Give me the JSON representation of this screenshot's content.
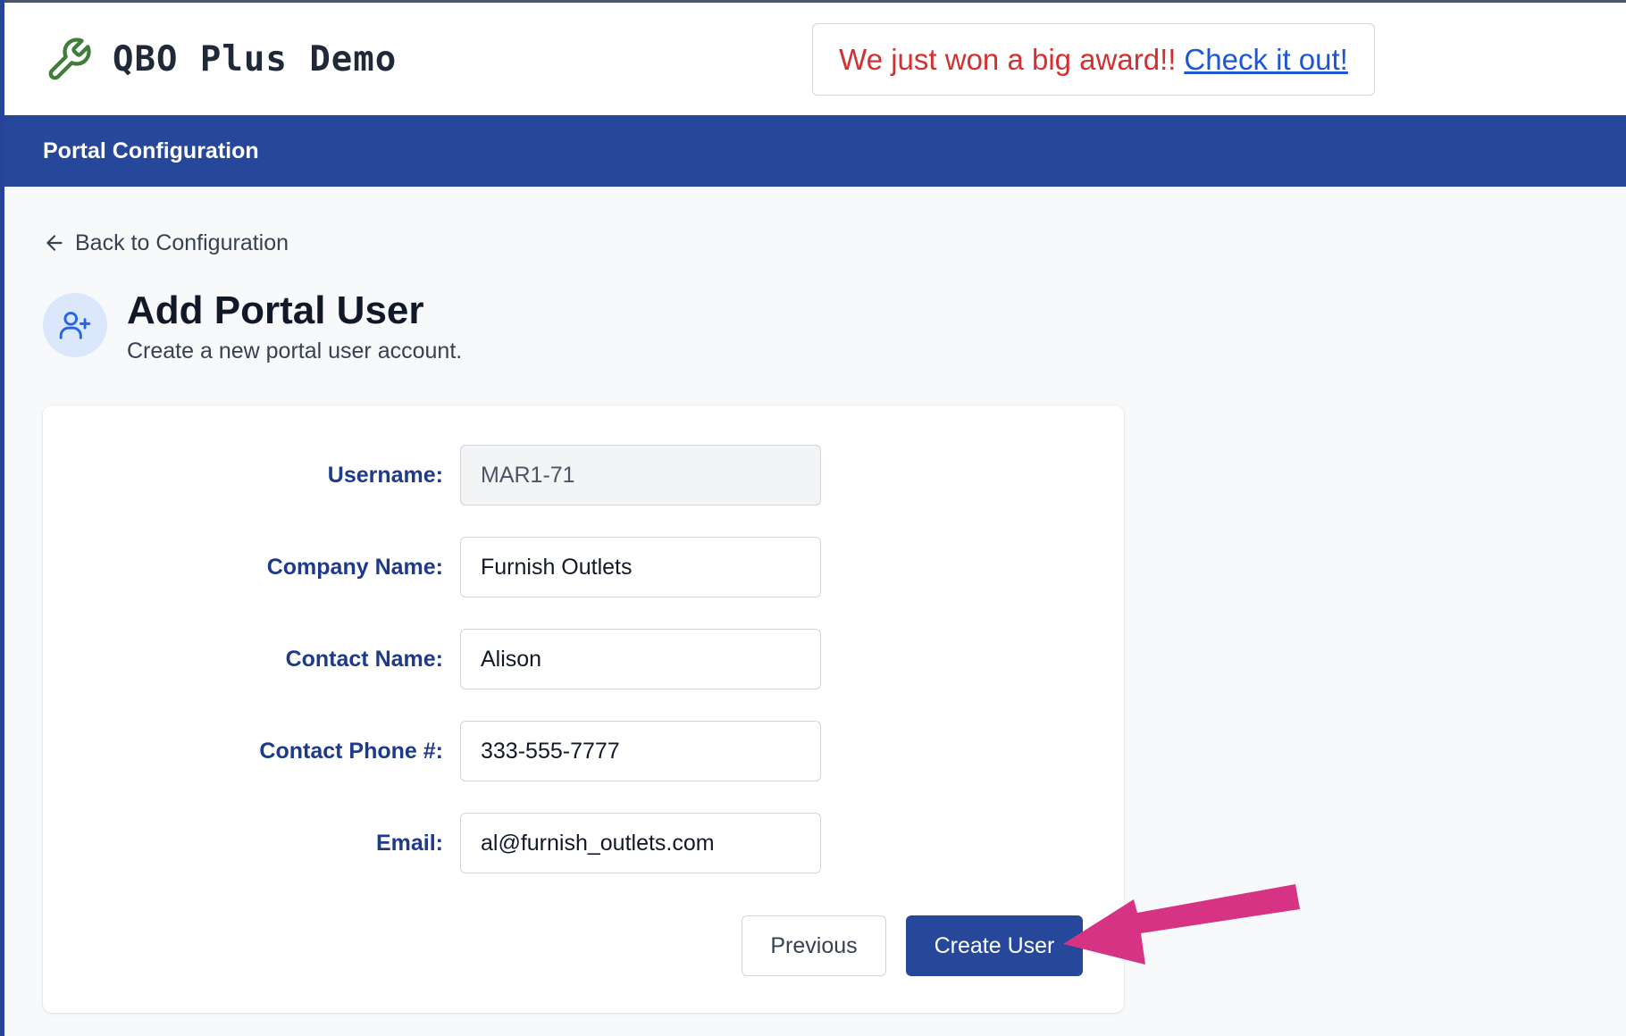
{
  "app": {
    "brand_name": "QBO Plus Demo",
    "logo_icon": "wrench-icon"
  },
  "announcement": {
    "text": "We just won a big award!!",
    "link_text": "Check it out!"
  },
  "nav": {
    "title": "Portal Configuration"
  },
  "back_link": {
    "label": "Back to Configuration",
    "icon": "arrow-left-icon"
  },
  "page": {
    "title": "Add Portal User",
    "subtitle": "Create a new portal user account.",
    "icon": "user-plus-icon"
  },
  "form": {
    "fields": [
      {
        "label": "Username:",
        "value": "MAR1-71",
        "readonly": true
      },
      {
        "label": "Company Name:",
        "value": "Furnish Outlets"
      },
      {
        "label": "Contact Name:",
        "value": "Alison"
      },
      {
        "label": "Contact Phone #:",
        "value": "333-555-7777"
      },
      {
        "label": "Email:",
        "value": "al@furnish_outlets.com"
      }
    ],
    "previous_label": "Previous",
    "create_label": "Create User"
  },
  "colors": {
    "nav_bg": "#26479a",
    "primary_button": "#26479a",
    "label_text": "#1e3a8a",
    "announcement_text": "#d3302f",
    "link": "#1f56d6",
    "logo_green": "#3f7d3a",
    "annotation_arrow": "#d63384"
  }
}
